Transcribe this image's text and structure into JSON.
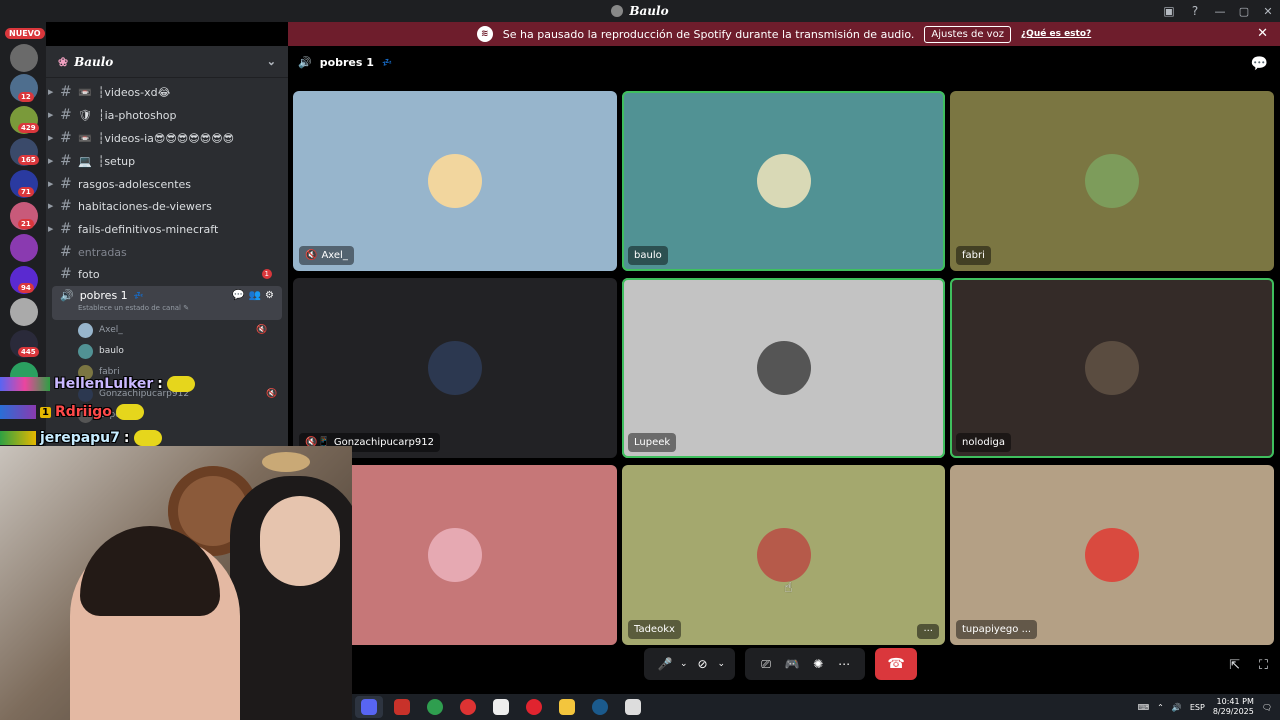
{
  "window": {
    "title": "Baulo"
  },
  "banner": {
    "text": "Se ha pausado la reproducción de Spotify durante la transmisión de audio.",
    "button": "Ajustes de voz",
    "link": "¿Qué es esto?"
  },
  "servers": {
    "nuevo": "NUEVO",
    "badges": [
      "12",
      "429",
      "165",
      "71",
      "21",
      "94",
      "445"
    ]
  },
  "guild": {
    "name": "Baulo"
  },
  "channels": [
    {
      "label": "┆videos-xd😂",
      "icon": "📼"
    },
    {
      "label": "┆ia-photoshop",
      "icon": "🛡"
    },
    {
      "label": "┆videos-ia😎😎😎😎😎😎😎",
      "icon": "📼"
    },
    {
      "label": "┆setup",
      "icon": "💻"
    },
    {
      "label": "rasgos-adolescentes"
    },
    {
      "label": "habitaciones-de-viewers"
    },
    {
      "label": "fails-definitivos-minecraft"
    },
    {
      "label": "entradas"
    },
    {
      "label": "foto",
      "badge": "1"
    }
  ],
  "voice_channel": {
    "name": "pobres 1",
    "zz": "💤",
    "status": "Establece un estado de canal",
    "members": [
      "Axel_",
      "baulo",
      "fabri",
      "Gonzachipucarp912",
      "Lupeek"
    ]
  },
  "stream_chat": [
    {
      "user": "HellenLulker",
      "suffix": ":",
      "color": "#c9b8ff"
    },
    {
      "user": "Rdriigo",
      "suffix": "",
      "color": "#ff4a4a",
      "badge": "1"
    },
    {
      "user": "jerepapu7",
      "suffix": ":",
      "color": "#c7ecff"
    }
  ],
  "call": {
    "title": "pobres 1",
    "zz": "💤"
  },
  "tiles": [
    {
      "name": "Axel_",
      "bg": "#97b5cc",
      "avatar": "#f2d69e",
      "icon": "🔇"
    },
    {
      "name": "baulo",
      "bg": "#519294",
      "avatar": "#d9d9b6",
      "speaking": true
    },
    {
      "name": "fabri",
      "bg": "#7b7642",
      "avatar": "#7d9c5b"
    },
    {
      "name": "Gonzachipucarp912",
      "bg": "#222225",
      "avatar": "#2c3850",
      "icon": "🔇📱"
    },
    {
      "name": "Lupeek",
      "bg": "#c3c3c3",
      "avatar": "#555555",
      "speaking": true
    },
    {
      "name": "nolodiga",
      "bg": "#342b28",
      "avatar": "#5a4c40",
      "speaking": true
    },
    {
      "name": "",
      "bg": "#c67778",
      "avatar": "#e6a9b2"
    },
    {
      "name": "Tadeokx",
      "bg": "#a4a86e",
      "avatar": "#b65a4a",
      "more": "···"
    },
    {
      "name": "tupapiyego ...",
      "bg": "#b4a085",
      "avatar": "#d94a3f"
    }
  ],
  "taskbar": {
    "lang": "ESP",
    "time": "10:41 PM",
    "date": "8/29/2025"
  }
}
